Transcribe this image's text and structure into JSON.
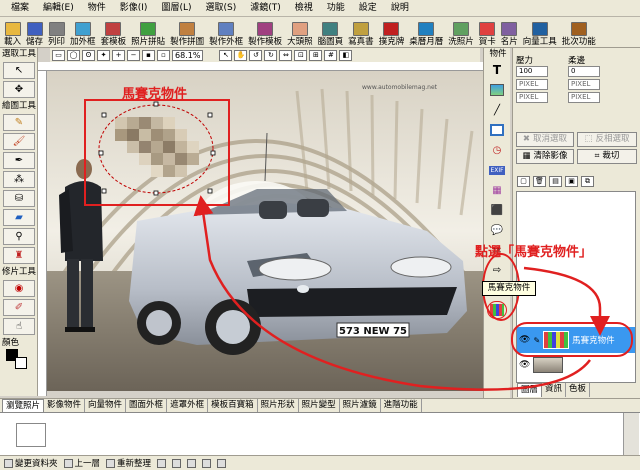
{
  "menu": [
    "檔案",
    "編輯(E)",
    "物件",
    "影像(I)",
    "圖層(L)",
    "選取(S)",
    "濾鏡(T)",
    "檢視",
    "功能",
    "設定",
    "說明"
  ],
  "toolbar": [
    {
      "label": "載入",
      "icon": "open-folder-icon",
      "color": "#e8b840"
    },
    {
      "label": "儲存",
      "icon": "save-disk-icon",
      "color": "#4060c0"
    },
    {
      "label": "列印",
      "icon": "printer-icon",
      "color": "#808080"
    },
    {
      "label": "加外框",
      "icon": "frame-icon",
      "color": "#40a0d0"
    },
    {
      "label": "套模板",
      "icon": "template-icon",
      "color": "#c04040"
    },
    {
      "label": "照片拼貼",
      "icon": "collage-icon",
      "color": "#40a040"
    },
    {
      "label": "製作拼圖",
      "icon": "puzzle-icon",
      "color": "#c08040"
    },
    {
      "label": "製作外框",
      "icon": "make-frame-icon",
      "color": "#6080c0"
    },
    {
      "label": "製作模板",
      "icon": "make-template-icon",
      "color": "#a04080"
    },
    {
      "label": "大頭照",
      "icon": "portrait-icon",
      "color": "#e0a080"
    },
    {
      "label": "腦圖頁",
      "icon": "mindmap-icon",
      "color": "#408080"
    },
    {
      "label": "寫真書",
      "icon": "photobook-icon",
      "color": "#c0a040"
    },
    {
      "label": "撲克牌",
      "icon": "playing-card-icon",
      "color": "#c02020"
    },
    {
      "label": "桌曆月曆",
      "icon": "calendar-icon",
      "color": "#2080c0"
    },
    {
      "label": "洗照片",
      "icon": "print-photo-icon",
      "color": "#60a060"
    },
    {
      "label": "賀卡",
      "icon": "greeting-card-icon",
      "color": "#e04040"
    },
    {
      "label": "名片",
      "icon": "business-card-icon",
      "color": "#8060a0"
    },
    {
      "label": "向量工具",
      "icon": "vector-tool-icon",
      "color": "#2060a0"
    },
    {
      "label": "批次功能",
      "icon": "batch-icon",
      "color": "#a06020"
    }
  ],
  "options_bar": {
    "zoom": "68.1%"
  },
  "left_tools": {
    "select_title": "選取工具",
    "draw_title": "繪圖工具",
    "retouch_title": "修片工具",
    "color_title": "顏色"
  },
  "canvas": {
    "annotation_label": "馬賽克物件",
    "callout_text": "點選「馬賽克物件」",
    "tooltip_text": "馬賽克物件",
    "watermark": "www.automobilemag.net",
    "plate_text": "573 NEW 75"
  },
  "object_tools": {
    "title": "物件"
  },
  "right_panel": {
    "pressure_label": "壓力",
    "softness_label": "柔邊",
    "pressure_value": "100",
    "softness_value": "0",
    "field_placeholders": [
      "PIXEL",
      "PIXEL",
      "PIXEL",
      "PIXEL"
    ],
    "cancel_select": "取消選取",
    "invert_select": "反相選取",
    "clear_image": "清除影像",
    "crop": "裁切",
    "layer_name": "馬賽克物件",
    "tabs": [
      "圖層",
      "資訊",
      "色板"
    ]
  },
  "bottom_tabs": [
    "瀏覽照片",
    "影像物件",
    "向量物件",
    "圖面外框",
    "遮罩外框",
    "模板百寶箱",
    "照片形狀",
    "照片變型",
    "照片濾鏡",
    "進階功能"
  ],
  "statusbar": [
    {
      "label": "變更資料夾",
      "icon": "folder-icon"
    },
    {
      "label": "上一層",
      "icon": "up-level-icon"
    },
    {
      "label": "重新整理",
      "icon": "refresh-icon"
    },
    {
      "label": "",
      "icon": "thumb-view-icon"
    },
    {
      "label": "",
      "icon": "list-view-icon"
    },
    {
      "label": "",
      "icon": "detail-view-icon"
    },
    {
      "label": "",
      "icon": "sort-icon"
    },
    {
      "label": "",
      "icon": "help-icon"
    }
  ]
}
